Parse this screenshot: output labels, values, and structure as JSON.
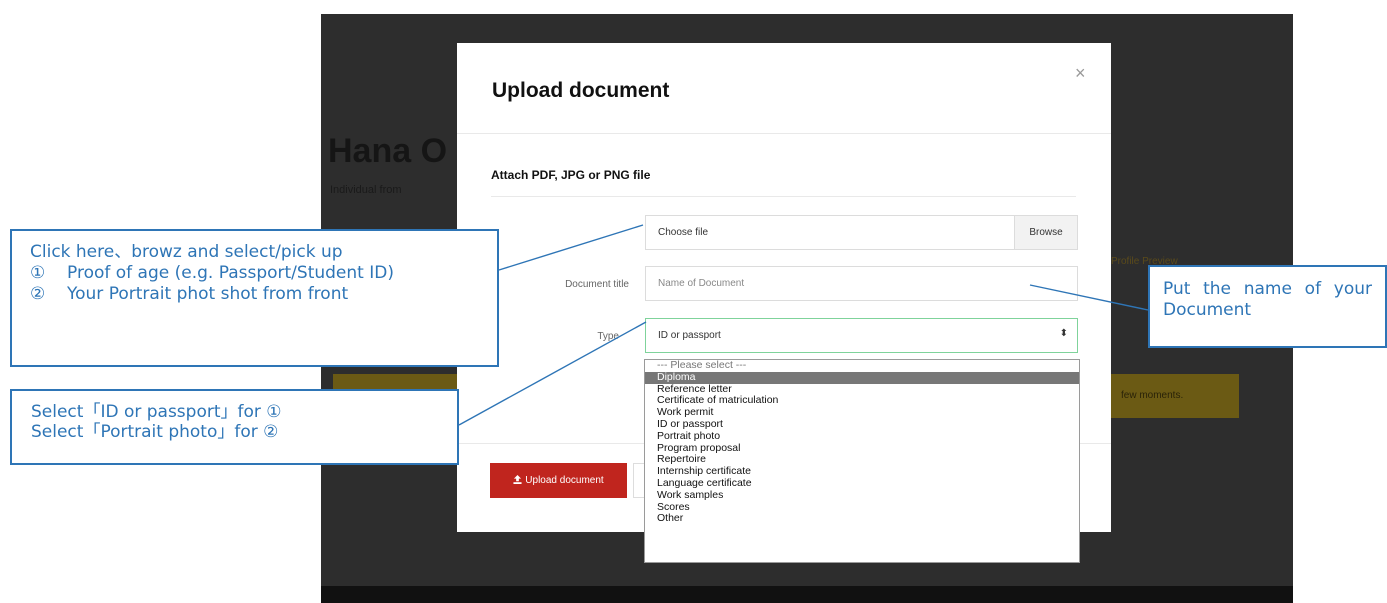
{
  "background": {
    "profile_name": "Hana O",
    "profile_subtitle": "Individual from",
    "side_link": "Profile Preview",
    "yellow_notice_tail": "few moments."
  },
  "modal": {
    "title": "Upload document",
    "close_glyph": "×",
    "attach_label": "Attach PDF, JPG or PNG file",
    "file_field": {
      "value": "Choose file",
      "browse_label": "Browse"
    },
    "document_title": {
      "label": "Document title",
      "placeholder": "Name of Document"
    },
    "type": {
      "label": "Type",
      "selected": "ID or passport",
      "arrow": "⬍"
    },
    "upload_button_label": "Upload document",
    "upload_icon": "upload-icon"
  },
  "dropdown_options": [
    "--- Please select ---",
    "Diploma",
    "Reference letter",
    "Certificate of matriculation",
    "Work permit",
    "ID or passport",
    "Portrait photo",
    "Program proposal",
    "Repertoire",
    "Internship certificate",
    "Language certificate",
    "Work samples",
    "Scores",
    "Other"
  ],
  "dropdown_highlighted": "Diploma",
  "annotations": {
    "file_callout": {
      "line1": "Click here、browz and select/pick up",
      "item1_num": "①",
      "item1_text": "Proof of age (e.g. Passport/Student ID)",
      "item2_num": "②",
      "item2_text": "Your Portrait phot shot from front"
    },
    "type_callout": {
      "line1": "Select「ID or passport」for ①",
      "line2": "Select「Portrait photo」for ②"
    },
    "title_callout": {
      "text": "Put the name of your Document"
    }
  },
  "colors": {
    "overlay": "#2d2d2d",
    "upload_button": "#c0251e",
    "callout_blue": "#2e75b6",
    "select_focus_border": "#7fd39b",
    "dropdown_highlight": "#777777"
  }
}
